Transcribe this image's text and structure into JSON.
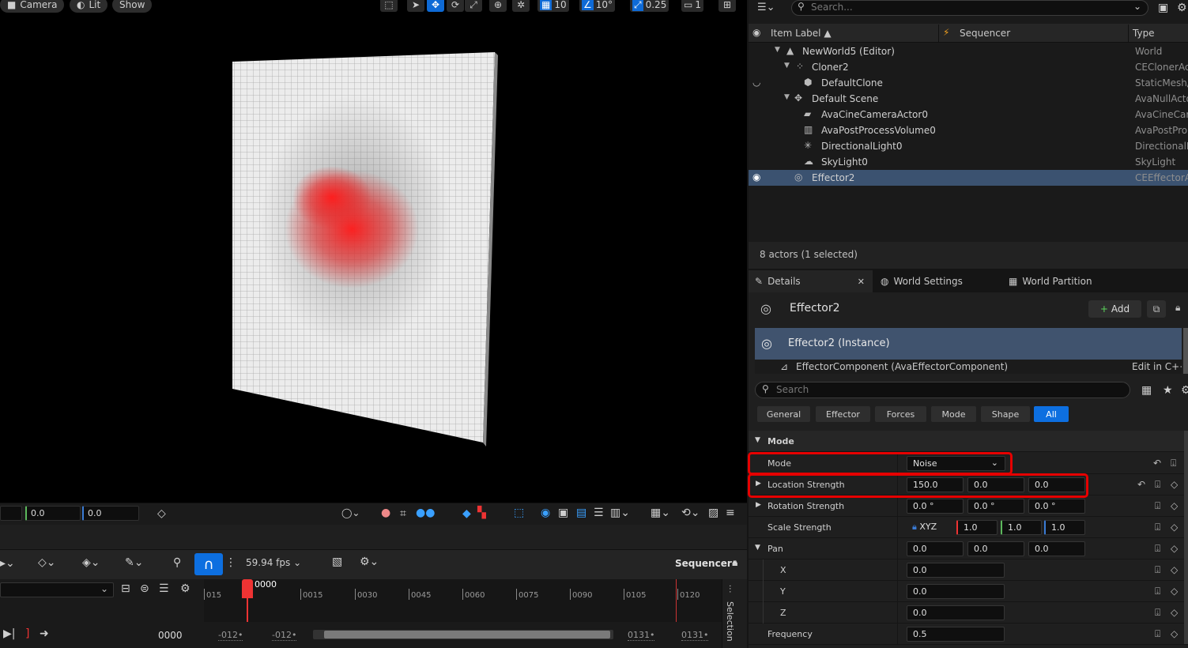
{
  "viewport": {
    "camera_label": "Camera",
    "lit_label": "Lit",
    "show_label": "Show",
    "grid_snap_value": "10",
    "rotation_snap_value": "10°",
    "scale_snap_value": "0.25",
    "camera_speed": "1",
    "bottom_fields": [
      "0.0",
      "0.0"
    ]
  },
  "sequencer": {
    "fps": "59.94 fps",
    "title": "Sequencer•",
    "current_frame_marker": "0000",
    "ticks": [
      "015",
      "0015",
      "0030",
      "0045",
      "0060",
      "0075",
      "0090",
      "0105",
      "0120"
    ],
    "current_frame": "0000",
    "range_start_1": "-012•",
    "range_start_2": "-012•",
    "range_end_1": "0131•",
    "range_end_2": "0131•",
    "selection_tab": "Selection"
  },
  "outliner": {
    "search_placeholder": "Search...",
    "columns": {
      "label": "Item Label ▲",
      "sequencer": "Sequencer",
      "type": "Type"
    },
    "rows": [
      {
        "label": "NewWorld5 (Editor)",
        "type": "World"
      },
      {
        "label": "Cloner2",
        "type": "CEClonerAc"
      },
      {
        "label": "DefaultClone",
        "type": "StaticMesh/"
      },
      {
        "label": "Default Scene",
        "type": "AvaNullActo"
      },
      {
        "label": "AvaCineCameraActor0",
        "type": "AvaCineCar"
      },
      {
        "label": "AvaPostProcessVolume0",
        "type": "AvaPostPro"
      },
      {
        "label": "DirectionalLight0",
        "type": "DirectionalL"
      },
      {
        "label": "SkyLight0",
        "type": "SkyLight"
      },
      {
        "label": "Effector2",
        "type": "CEEffectorA"
      }
    ],
    "status": "8 actors (1 selected)"
  },
  "details": {
    "tabs": [
      "Details",
      "World Settings",
      "World Partition"
    ],
    "actor_name": "Effector2",
    "add_label": "Add",
    "instance_label": "Effector2 (Instance)",
    "component_label": "EffectorComponent (AvaEffectorComponent)",
    "edit_cpp": "Edit in C++",
    "search_placeholder": "Search",
    "filters": [
      "General",
      "Effector",
      "Forces",
      "Mode",
      "Shape",
      "All"
    ],
    "section_title": "Mode",
    "props": {
      "mode": {
        "label": "Mode",
        "value": "Noise"
      },
      "location_strength": {
        "label": "Location Strength",
        "x": "150.0",
        "y": "0.0",
        "z": "0.0"
      },
      "rotation_strength": {
        "label": "Rotation Strength",
        "x": "0.0 °",
        "y": "0.0 °",
        "z": "0.0 °"
      },
      "scale_strength": {
        "label": "Scale Strength",
        "lock": "XYZ",
        "x": "1.0",
        "y": "1.0",
        "z": "1.0"
      },
      "pan": {
        "label": "Pan",
        "x": "0.0",
        "y": "0.0",
        "z": "0.0"
      },
      "pan_x": {
        "label": "X",
        "value": "0.0"
      },
      "pan_y": {
        "label": "Y",
        "value": "0.0"
      },
      "pan_z": {
        "label": "Z",
        "value": "0.0"
      },
      "frequency": {
        "label": "Frequency",
        "value": "0.5"
      }
    }
  },
  "colors": {
    "selection_blue": "#0d6fe0",
    "highlight_red": "#e60000",
    "selected_row": "#3b5270"
  }
}
